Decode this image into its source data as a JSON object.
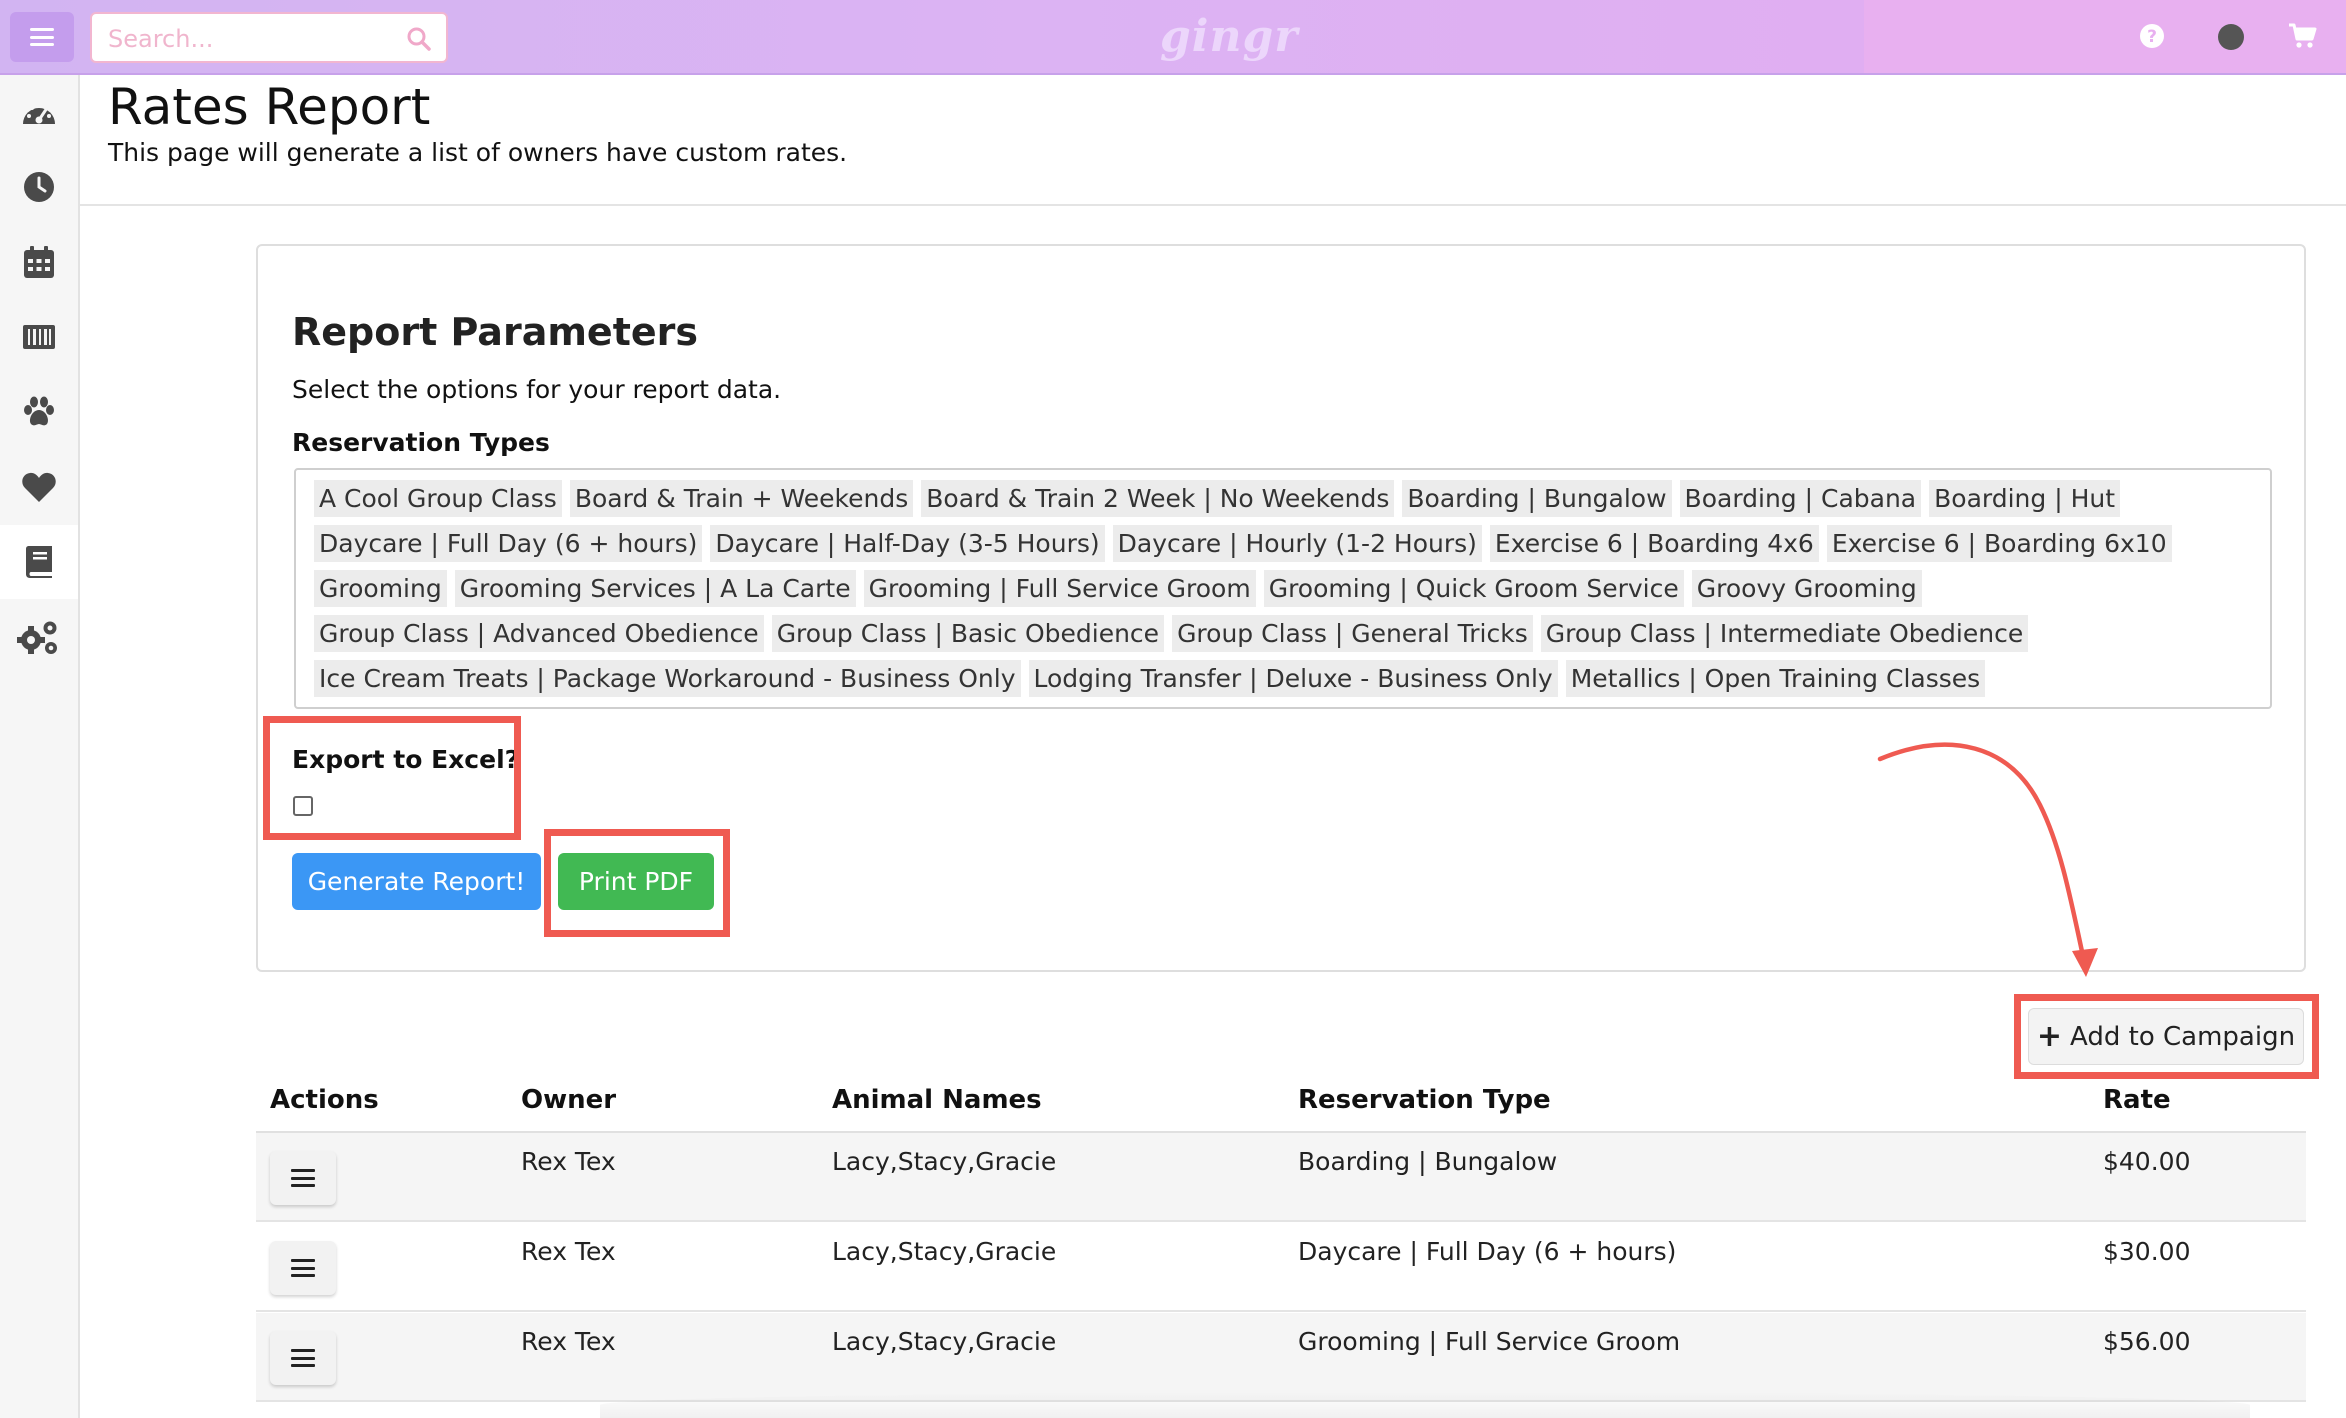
{
  "topbar": {
    "search_placeholder": "Search...",
    "logo": "gingr",
    "icons": [
      "hamburger-menu-icon",
      "search-icon",
      "help-icon",
      "user-status-dot",
      "shopping-cart-icon"
    ],
    "accent_color": "#d2b4f2"
  },
  "sidebar": {
    "items": [
      {
        "name": "dashboard",
        "icon": "speedometer-icon"
      },
      {
        "name": "history",
        "icon": "clock-icon"
      },
      {
        "name": "calendar",
        "icon": "calendar-icon"
      },
      {
        "name": "barcode",
        "icon": "barcode-icon"
      },
      {
        "name": "animals",
        "icon": "paw-icon"
      },
      {
        "name": "favorites",
        "icon": "heart-icon"
      },
      {
        "name": "reports",
        "icon": "book-icon",
        "active": true
      },
      {
        "name": "settings",
        "icon": "gears-icon"
      }
    ]
  },
  "header": {
    "title": "Rates Report",
    "subtitle": "This page will generate a list of owners have custom rates."
  },
  "params": {
    "title": "Report Parameters",
    "subtitle": "Select the options for your report data.",
    "reservation_types_label": "Reservation Types",
    "reservation_types": [
      "A Cool Group Class",
      "Board & Train + Weekends",
      "Board & Train 2 Week | No Weekends",
      "Boarding | Bungalow",
      "Boarding | Cabana",
      "Boarding | Hut",
      "Daycare | Full Day (6 + hours)",
      "Daycare | Half-Day (3-5 Hours)",
      "Daycare | Hourly (1-2 Hours)",
      "Exercise 6 | Boarding 4x6",
      "Exercise 6 | Boarding 6x10",
      "Grooming",
      "Grooming Services | A La Carte",
      "Grooming | Full Service Groom",
      "Grooming | Quick Groom Service",
      "Groovy Grooming",
      "Group Class | Advanced Obedience",
      "Group Class | Basic Obedience",
      "Group Class | General Tricks",
      "Group Class | Intermediate Obedience",
      "Ice Cream Treats | Package Workaround - Business Only",
      "Lodging Transfer | Deluxe - Business Only",
      "Metallics | Open Training Classes"
    ],
    "export_label": "Export to Excel?",
    "export_checked": false,
    "generate_label": "Generate Report!",
    "print_label": "Print PDF",
    "generate_color": "#3b97f5",
    "print_color": "#41b953",
    "highlight_color": "#ef5a51"
  },
  "campaign": {
    "label": "Add to Campaign",
    "icon": "plus-icon"
  },
  "table": {
    "columns": [
      "Actions",
      "Owner",
      "Animal Names",
      "Reservation Type",
      "Rate"
    ],
    "rows": [
      {
        "owner": "Rex Tex",
        "animals": "Lacy,Stacy,Gracie",
        "reservation_type": "Boarding | Bungalow",
        "rate": "$40.00"
      },
      {
        "owner": "Rex Tex",
        "animals": "Lacy,Stacy,Gracie",
        "reservation_type": "Daycare | Full Day (6 + hours)",
        "rate": "$30.00"
      },
      {
        "owner": "Rex Tex",
        "animals": "Lacy,Stacy,Gracie",
        "reservation_type": "Grooming | Full Service Groom",
        "rate": "$56.00"
      }
    ]
  }
}
